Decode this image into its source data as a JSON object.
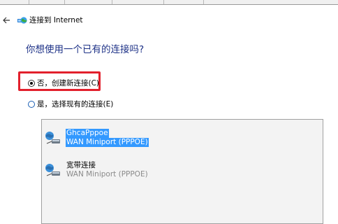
{
  "window": {
    "title": "连接到 Internet",
    "back_icon": "arrow-left-icon",
    "app_icon": "network-globe-icon"
  },
  "heading": "你想使用一个已有的连接吗?",
  "options": [
    {
      "label": "否，创建新连接(C)",
      "checked": true
    },
    {
      "label": "是，选择现有的连接(E)",
      "checked": false
    }
  ],
  "connections": [
    {
      "name": "GhcaPppoe",
      "device": "WAN Miniport (PPPOE)",
      "selected": true
    },
    {
      "name": "宽带连接",
      "device": "WAN Miniport (PPPOE)",
      "selected": false
    }
  ],
  "colors": {
    "heading": "#1e3287",
    "highlight_box": "#e2202c",
    "selection": "#3399ff"
  }
}
